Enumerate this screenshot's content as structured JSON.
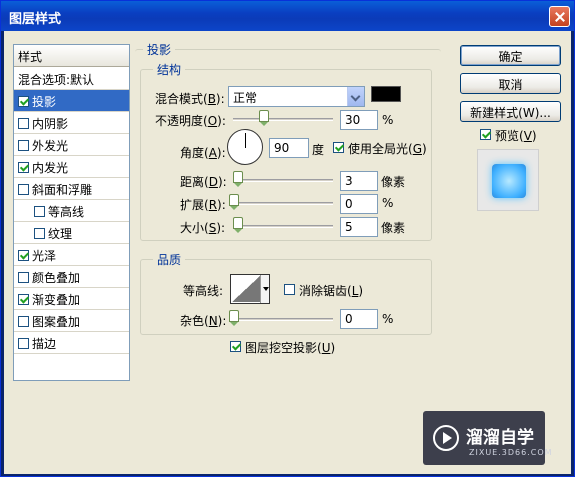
{
  "window": {
    "title": "图层样式"
  },
  "sidebar": {
    "header": "样式",
    "items": [
      {
        "label": "混合选项:默认",
        "checkbox": false,
        "checked": false,
        "selected": false,
        "indent": 0
      },
      {
        "label": "投影",
        "checkbox": true,
        "checked": true,
        "selected": true,
        "indent": 0
      },
      {
        "label": "内阴影",
        "checkbox": true,
        "checked": false,
        "selected": false,
        "indent": 0
      },
      {
        "label": "外发光",
        "checkbox": true,
        "checked": false,
        "selected": false,
        "indent": 0
      },
      {
        "label": "内发光",
        "checkbox": true,
        "checked": true,
        "selected": false,
        "indent": 0
      },
      {
        "label": "斜面和浮雕",
        "checkbox": true,
        "checked": false,
        "selected": false,
        "indent": 0
      },
      {
        "label": "等高线",
        "checkbox": true,
        "checked": false,
        "selected": false,
        "indent": 1
      },
      {
        "label": "纹理",
        "checkbox": true,
        "checked": false,
        "selected": false,
        "indent": 1
      },
      {
        "label": "光泽",
        "checkbox": true,
        "checked": true,
        "selected": false,
        "indent": 0
      },
      {
        "label": "颜色叠加",
        "checkbox": true,
        "checked": false,
        "selected": false,
        "indent": 0
      },
      {
        "label": "渐变叠加",
        "checkbox": true,
        "checked": true,
        "selected": false,
        "indent": 0
      },
      {
        "label": "图案叠加",
        "checkbox": true,
        "checked": false,
        "selected": false,
        "indent": 0
      },
      {
        "label": "描边",
        "checkbox": true,
        "checked": false,
        "selected": false,
        "indent": 0
      }
    ]
  },
  "shadow": {
    "title": "投影",
    "structure": {
      "title": "结构",
      "blend_mode_label": "混合模式(",
      "blend_mode_key": "B",
      "blend_mode_value": "正常",
      "shadow_color": "#000000",
      "opacity_label": "不透明度(",
      "opacity_key": "O",
      "opacity_value": "30",
      "opacity_level": 30,
      "percent": "%",
      "angle_label": "角度(",
      "angle_key": "A",
      "angle_value": "90",
      "angle_unit": "度",
      "global_light_label": "使用全局光(",
      "global_light_key": "G",
      "global_light_checked": true,
      "distance_label": "距离(",
      "distance_key": "D",
      "distance_value": "3",
      "spread_label": "扩展(",
      "spread_key": "R",
      "spread_value": "0",
      "size_label": "大小(",
      "size_key": "S",
      "size_value": "5",
      "pixel_unit": "像素"
    },
    "quality": {
      "title": "品质",
      "contour_label": "等高线:",
      "anti_alias_label": "消除锯齿(",
      "anti_alias_key": "L",
      "anti_alias_checked": false,
      "noise_label": "杂色(",
      "noise_key": "N",
      "noise_value": "0",
      "percent": "%"
    },
    "knockout_label": "图层挖空投影(",
    "knockout_key": "U",
    "knockout_checked": true,
    "close_paren": "):",
    "close_paren_plain": ")"
  },
  "buttons": {
    "ok": "确定",
    "cancel": "取消",
    "new_style": "新建样式(W)...",
    "preview_label": "预览(",
    "preview_key": "V",
    "preview_checked": true
  },
  "watermark": {
    "text": "溜溜自学",
    "sub": "ZIXUE.3D66.COM"
  }
}
